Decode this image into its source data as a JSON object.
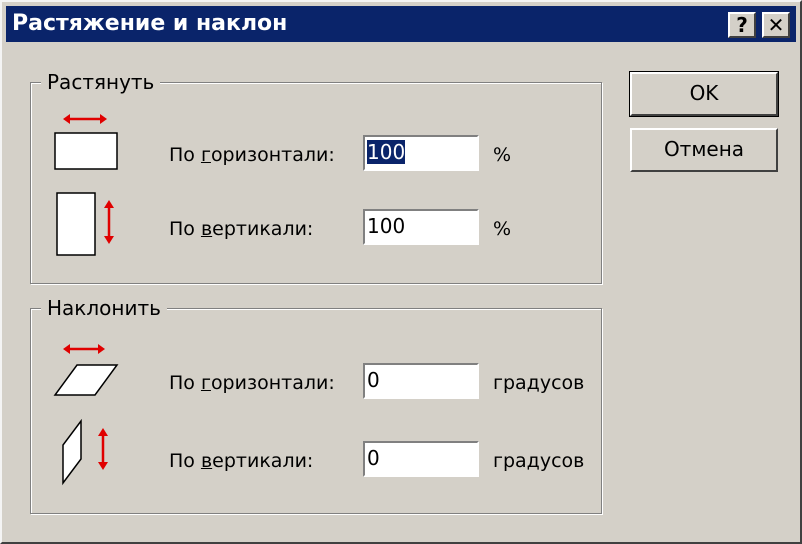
{
  "window": {
    "title": "Растяжение и наклон",
    "help_label": "?",
    "close_label": "✕"
  },
  "stretch_group": {
    "label": "Растянуть",
    "horizontal": {
      "label_prefix": "По ",
      "label_accel": "г",
      "label_rest": "оризонтали:",
      "value_selected": "100",
      "unit": "%"
    },
    "vertical": {
      "label_prefix": "По ",
      "label_accel": "в",
      "label_rest": "ертикали:",
      "value": "100",
      "unit": "%"
    }
  },
  "skew_group": {
    "label": "Наклонить",
    "horizontal": {
      "label_prefix": "По ",
      "label_accel": "г",
      "label_rest": "оризонтали:",
      "value": "0",
      "unit": "градусов"
    },
    "vertical": {
      "label_prefix": "По ",
      "label_accel": "в",
      "label_rest": "ертикали:",
      "value": "0",
      "unit": "градусов"
    }
  },
  "buttons": {
    "ok_label": "OK",
    "cancel_label": "Отмена"
  },
  "colors": {
    "titlebar": "#0a246a",
    "dialog_bg": "#d4d0c8",
    "arrow": "#e00000"
  }
}
